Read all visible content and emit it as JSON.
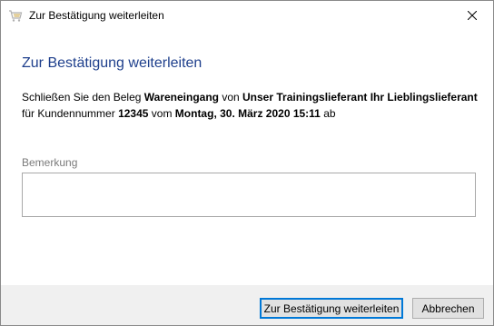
{
  "window": {
    "title": "Zur Bestätigung weiterleiten",
    "app_icon": "shopping-cart-icon",
    "close_icon": "close-icon"
  },
  "dialog": {
    "heading": "Zur Bestätigung weiterleiten",
    "message": {
      "part1": "Schließen Sie den Beleg ",
      "document_type": "Wareneingang",
      "part2": " von ",
      "supplier": "Unser Trainingslieferant Ihr Lieblingslieferant",
      "part3": "für Kundennummer ",
      "customer_number": "12345",
      "part4": " vom ",
      "date": "Montag, 30. März 2020 15:11",
      "part5": " ab"
    },
    "remark": {
      "label": "Bemerkung",
      "value": ""
    }
  },
  "buttons": {
    "confirm_label": "Zur Bestätigung weiterleiten",
    "cancel_label": "Abbrechen"
  },
  "colors": {
    "heading": "#1e3f8c",
    "footer_bg": "#f0f0f0",
    "primary_border": "#0078d7"
  }
}
